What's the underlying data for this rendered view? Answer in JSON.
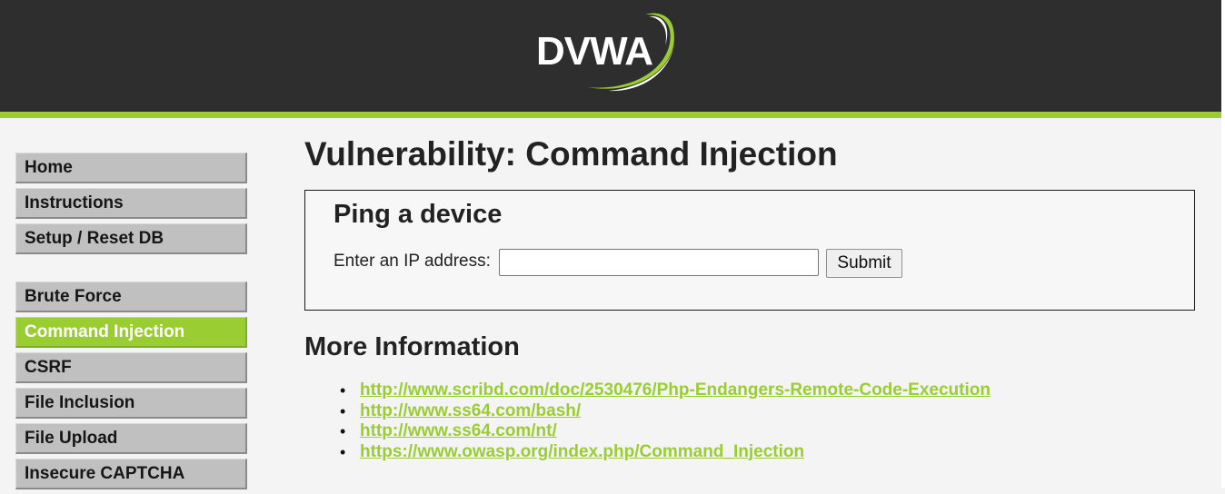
{
  "header": {
    "logo_text": "DVWA",
    "background_color": "#2e2e2e",
    "accent_color": "#9acd32"
  },
  "sidebar": {
    "groups": [
      {
        "items": [
          {
            "label": "Home"
          },
          {
            "label": "Instructions"
          },
          {
            "label": "Setup / Reset DB"
          }
        ]
      },
      {
        "items": [
          {
            "label": "Brute Force"
          },
          {
            "label": "Command Injection",
            "selected": true
          },
          {
            "label": "CSRF"
          },
          {
            "label": "File Inclusion"
          },
          {
            "label": "File Upload"
          },
          {
            "label": "Insecure CAPTCHA"
          }
        ]
      }
    ]
  },
  "main": {
    "title": "Vulnerability: Command Injection",
    "ping_form": {
      "heading": "Ping a device",
      "label": "Enter an IP address:",
      "input_value": "",
      "submit_label": "Submit"
    },
    "more_info": {
      "heading": "More Information",
      "links": [
        "http://www.scribd.com/doc/2530476/Php-Endangers-Remote-Code-Execution",
        "http://www.ss64.com/bash/",
        "http://www.ss64.com/nt/",
        "https://www.owasp.org/index.php/Command_Injection"
      ]
    }
  }
}
